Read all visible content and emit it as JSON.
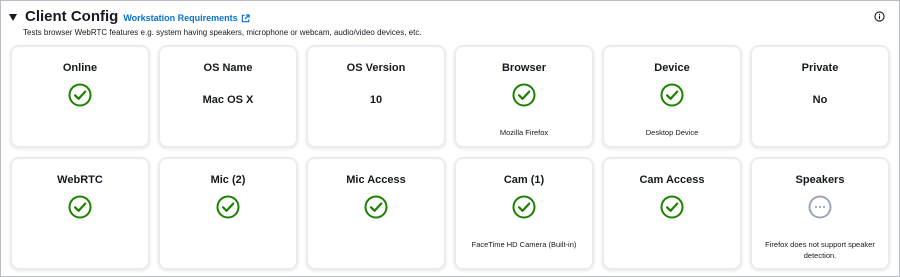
{
  "header": {
    "title": "Client Config",
    "link_label": "Workstation Requirements",
    "description": "Tests browser WebRTC features e.g. system having speakers, microphone or webcam, audio/video devices, etc."
  },
  "colors": {
    "ok": "#1d8102",
    "pending": "#9ba7b6",
    "link": "#0972d3"
  },
  "cards": [
    {
      "title": "Online",
      "status": "ok"
    },
    {
      "title": "OS Name",
      "value": "Mac OS X"
    },
    {
      "title": "OS Version",
      "value": "10"
    },
    {
      "title": "Browser",
      "status": "ok",
      "detail": "Mozilla Firefox"
    },
    {
      "title": "Device",
      "status": "ok",
      "detail": "Desktop Device"
    },
    {
      "title": "Private",
      "value": "No"
    },
    {
      "title": "WebRTC",
      "status": "ok"
    },
    {
      "title": "Mic (2)",
      "status": "ok"
    },
    {
      "title": "Mic Access",
      "status": "ok"
    },
    {
      "title": "Cam (1)",
      "status": "ok",
      "detail": "FaceTime HD Camera (Built-in)"
    },
    {
      "title": "Cam Access",
      "status": "ok"
    },
    {
      "title": "Speakers",
      "status": "pending",
      "detail": "Firefox does not support speaker detection."
    }
  ]
}
